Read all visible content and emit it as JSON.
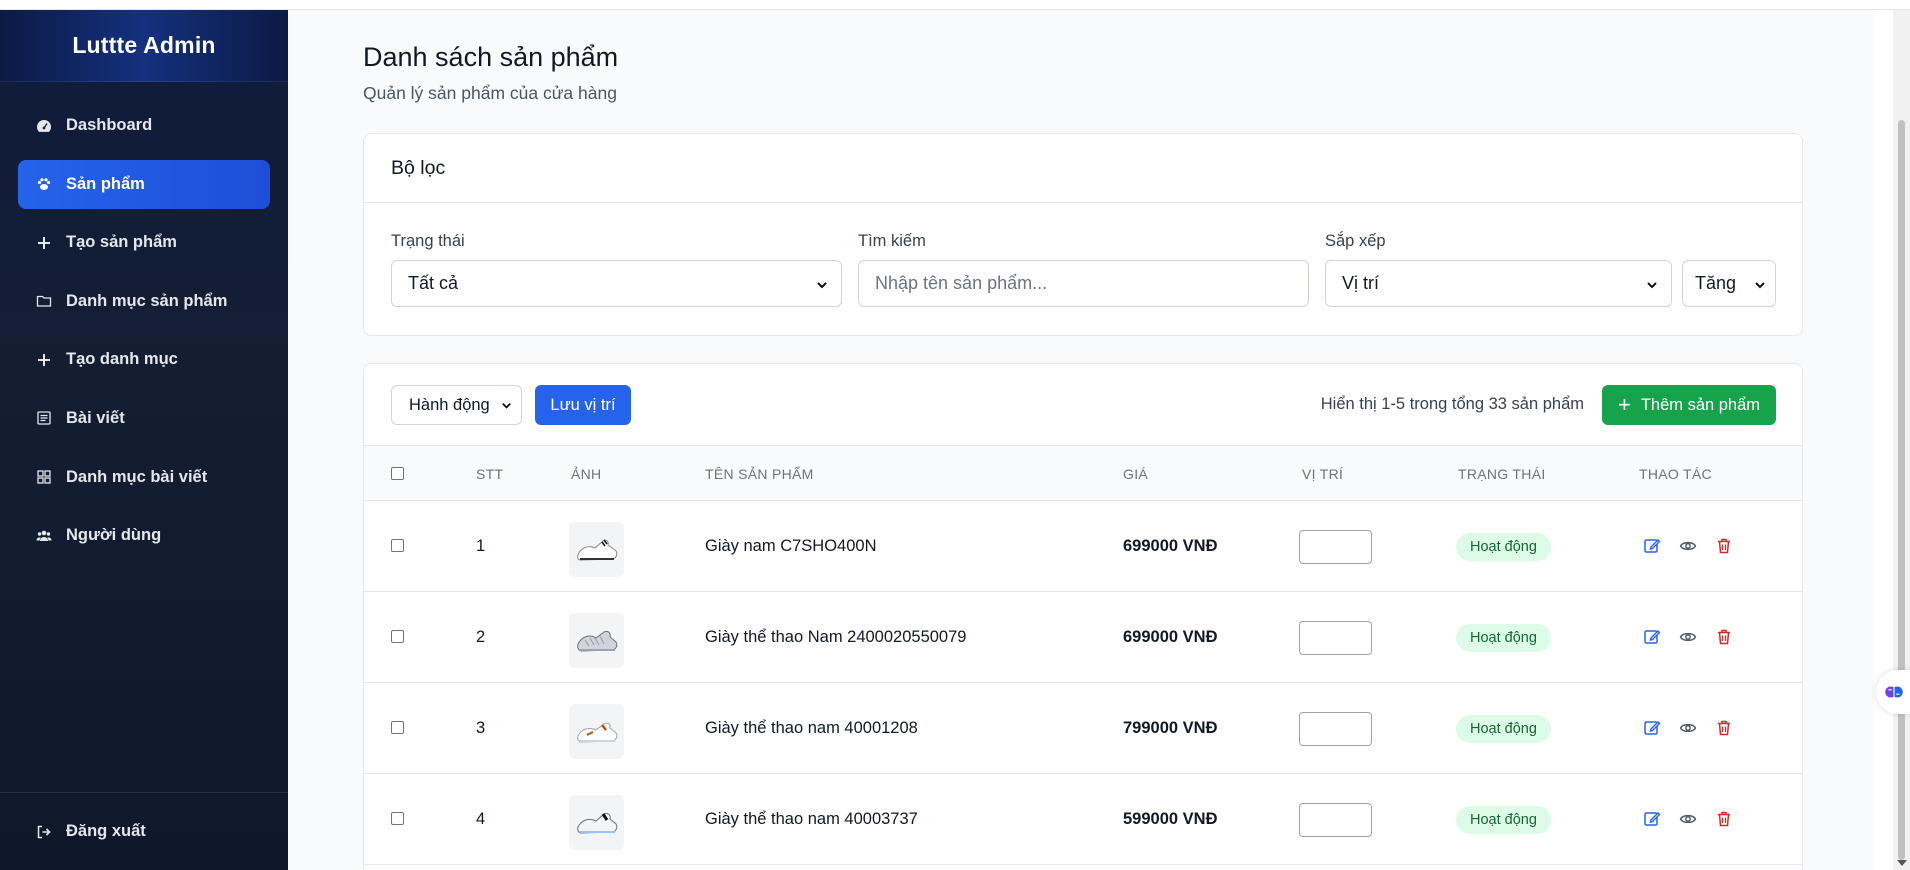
{
  "app": {
    "brand": "Luttte Admin"
  },
  "sidebar": {
    "items": [
      {
        "label": "Dashboard",
        "icon": "gauge-icon",
        "active": false
      },
      {
        "label": "Sản phẩm",
        "icon": "paw-icon",
        "active": true
      },
      {
        "label": "Tạo sản phẩm",
        "icon": "plus-icon",
        "active": false
      },
      {
        "label": "Danh mục sản phẩm",
        "icon": "folder-icon",
        "active": false
      },
      {
        "label": "Tạo danh mục",
        "icon": "plus-icon",
        "active": false
      },
      {
        "label": "Bài viết",
        "icon": "newspaper-icon",
        "active": false
      },
      {
        "label": "Danh mục bài viết",
        "icon": "grid-icon",
        "active": false
      },
      {
        "label": "Người dùng",
        "icon": "users-icon",
        "active": false
      }
    ],
    "logout": {
      "label": "Đăng xuất",
      "icon": "sign-out-icon"
    }
  },
  "page": {
    "title": "Danh sách sản phẩm",
    "subtitle": "Quản lý sản phẩm của cửa hàng"
  },
  "filters": {
    "title": "Bộ lọc",
    "status_label": "Trạng thái",
    "status_value": "Tất cả",
    "search_label": "Tìm kiếm",
    "search_placeholder": "Nhập tên sản phẩm...",
    "sort_label": "Sắp xếp",
    "sort_value": "Vị trí",
    "sort_order": "Tăng"
  },
  "toolbar": {
    "action_select": "Hành động",
    "save_position": "Lưu vị trí",
    "showing": "Hiển thị 1-5 trong tổng 33 sản phẩm",
    "add_product": "Thêm sản phẩm"
  },
  "table": {
    "headers": [
      "STT",
      "ẢNH",
      "TÊN SẢN PHẨM",
      "GIÁ",
      "VỊ TRÍ",
      "TRẠNG THÁI",
      "THAO TÁC"
    ],
    "rows": [
      {
        "stt": "1",
        "name": "Giày nam C7SHO400N",
        "price": "699000 VNĐ",
        "position": "",
        "status": "Hoạt động"
      },
      {
        "stt": "2",
        "name": "Giày thể thao Nam 2400020550079",
        "price": "699000 VNĐ",
        "position": "",
        "status": "Hoạt động"
      },
      {
        "stt": "3",
        "name": "Giày thể thao nam 40001208",
        "price": "799000 VNĐ",
        "position": "",
        "status": "Hoạt động"
      },
      {
        "stt": "4",
        "name": "Giày thể thao nam 40003737",
        "price": "599000 VNĐ",
        "position": "",
        "status": "Hoạt động"
      }
    ]
  },
  "colors": {
    "primary": "#2563eb",
    "success": "#16a34a",
    "danger": "#dc2626",
    "sidebar_bg": "#141e33",
    "badge_bg": "#dcfce7",
    "badge_text": "#166534"
  }
}
